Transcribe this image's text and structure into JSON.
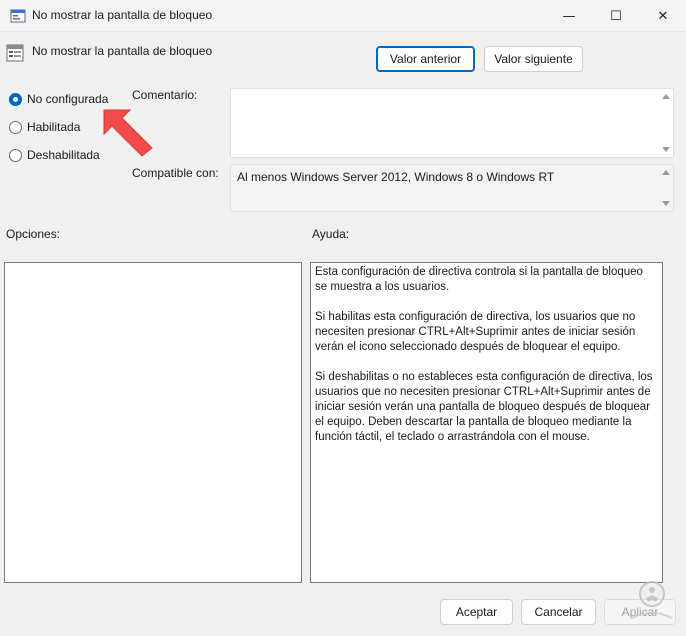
{
  "window": {
    "title": "No mostrar la pantalla de bloqueo",
    "minimize_glyph": "—",
    "maximize_glyph": "☐",
    "close_glyph": "✕"
  },
  "policy": {
    "name": "No mostrar la pantalla de bloqueo"
  },
  "nav": {
    "previous_label": "Valor anterior",
    "next_label": "Valor siguiente"
  },
  "state": {
    "options": [
      {
        "label": "No configurada",
        "checked": true
      },
      {
        "label": "Habilitada",
        "checked": false
      },
      {
        "label": "Deshabilitada",
        "checked": false
      }
    ]
  },
  "comment": {
    "label": "Comentario:",
    "value": ""
  },
  "compatible": {
    "label": "Compatible con:",
    "value": "Al menos Windows Server 2012, Windows 8 o Windows RT"
  },
  "options_section": {
    "label": "Opciones:"
  },
  "help_section": {
    "label": "Ayuda:",
    "paragraphs": [
      "Esta configuración de directiva controla si la pantalla de bloqueo se muestra a los usuarios.",
      "Si habilitas esta configuración de directiva, los usuarios que no necesiten presionar CTRL+Alt+Suprimir antes de iniciar sesión verán el icono seleccionado después de bloquear el equipo.",
      "Si deshabilitas o no estableces esta configuración de directiva, los usuarios que no necesiten presionar CTRL+Alt+Suprimir antes de iniciar sesión verán una pantalla de bloqueo después de bloquear el equipo. Deben descartar la pantalla de bloqueo mediante la función táctil, el teclado o arrastrándola con el mouse."
    ]
  },
  "footer": {
    "accept_label": "Aceptar",
    "cancel_label": "Cancelar",
    "apply_label": "Aplicar"
  },
  "colors": {
    "accent": "#0067c0",
    "annotation_arrow": "#f24b4b"
  },
  "icons": [
    "policy-settings-icon",
    "annotation-arrow",
    "watermark-logo"
  ]
}
